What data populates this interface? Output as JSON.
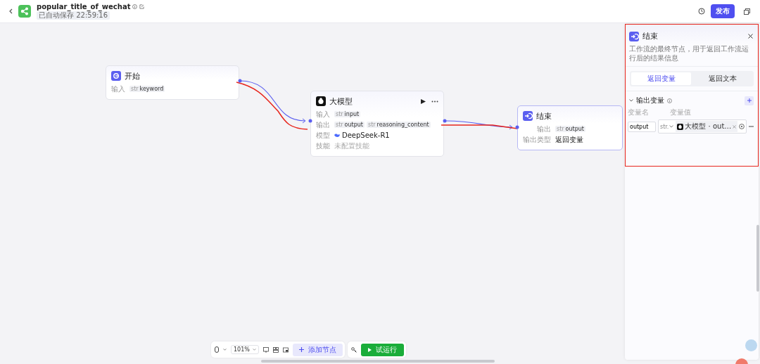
{
  "header": {
    "title": "popular_title_of_wechat",
    "save_status": "已自动保存 22:59:16",
    "publish": "发布"
  },
  "nodes": [
    {
      "kind": "start",
      "title": "开始",
      "rows": [
        {
          "label": "输入",
          "tags": [
            {
              "type": "str",
              "name": "keyword"
            }
          ]
        }
      ]
    },
    {
      "kind": "llm",
      "title": "大模型",
      "rows": [
        {
          "label": "输入",
          "tags": [
            {
              "type": "str",
              "name": "input"
            }
          ]
        },
        {
          "label": "输出",
          "tags": [
            {
              "type": "str",
              "name": "output"
            },
            {
              "type": "str",
              "name": "reasoning_content"
            }
          ]
        },
        {
          "label": "模型",
          "model": "DeepSeek-R1"
        },
        {
          "label": "技能",
          "text": "未配置技能"
        }
      ]
    },
    {
      "kind": "end",
      "title": "结束",
      "rows": [
        {
          "label": "输出",
          "tags": [
            {
              "type": "str",
              "name": "output"
            }
          ]
        },
        {
          "label": "输出类型",
          "text": "返回变量"
        }
      ]
    }
  ],
  "panel": {
    "title": "结束",
    "description": "工作流的最终节点，用于返回工作流运行后的结果信息",
    "tabs": [
      {
        "label": "返回变量",
        "selected": true
      },
      {
        "label": "返回文本",
        "selected": false
      }
    ],
    "section": {
      "title": "输出变量",
      "expanded": true,
      "columns": [
        "变量名",
        "变量值"
      ],
      "rows": [
        {
          "name": "output",
          "type": "str.",
          "ref": "大模型 · out…"
        }
      ]
    }
  },
  "toolbar": {
    "zoom": "101%",
    "add_node": "添加节点",
    "run": "试运行"
  }
}
